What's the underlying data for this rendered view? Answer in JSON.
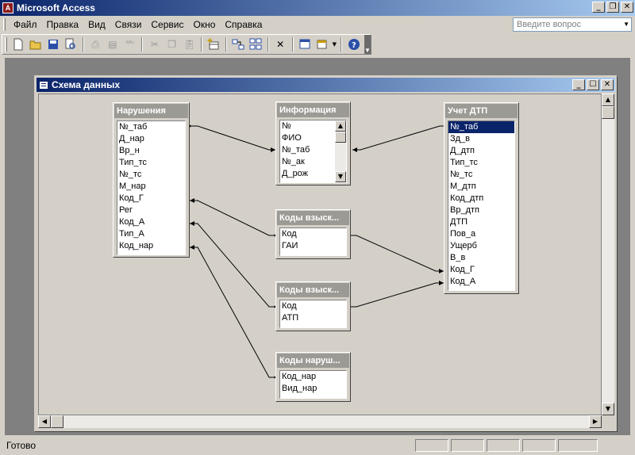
{
  "app": {
    "title": "Microsoft Access",
    "icon": "access-icon"
  },
  "menu": [
    {
      "label": "Файл"
    },
    {
      "label": "Правка"
    },
    {
      "label": "Вид"
    },
    {
      "label": "Связи"
    },
    {
      "label": "Сервис"
    },
    {
      "label": "Окно"
    },
    {
      "label": "Справка"
    }
  ],
  "help": {
    "placeholder": "Введите вопрос"
  },
  "window": {
    "title": "Схема данных"
  },
  "tables": {
    "narusheniya": {
      "title": "Нарушения",
      "fields": [
        "№_таб",
        "Д_нар",
        "Вр_н",
        "Тип_тс",
        "№_тс",
        "М_нар",
        "Код_Г",
        "Рег",
        "Код_А",
        "Тип_А",
        "Код_нар"
      ]
    },
    "informaciya": {
      "title": "Информация",
      "fields": [
        "№",
        "ФИО",
        "№_таб",
        "№_ак",
        "Д_рож"
      ]
    },
    "kody_gai": {
      "title": "Коды взыск...",
      "fields": [
        "Код",
        "ГАИ"
      ]
    },
    "kody_atp": {
      "title": "Коды взыск...",
      "fields": [
        "Код",
        "АТП"
      ]
    },
    "kody_nar": {
      "title": "Коды наруш...",
      "fields": [
        "Код_нар",
        "Вид_нар"
      ]
    },
    "uchet_dtp": {
      "title": "Учет ДТП",
      "fields": [
        "№_таб",
        "Зд_в",
        "Д_дтп",
        "Тип_тс",
        "№_тс",
        "М_дтп",
        "Код_дтп",
        "Вр_дтп",
        "ДТП",
        "Пов_а",
        "Ущерб",
        "В_в",
        "Код_Г",
        "Код_А"
      ],
      "selected": "№_таб"
    }
  },
  "status": {
    "text": "Готово"
  }
}
